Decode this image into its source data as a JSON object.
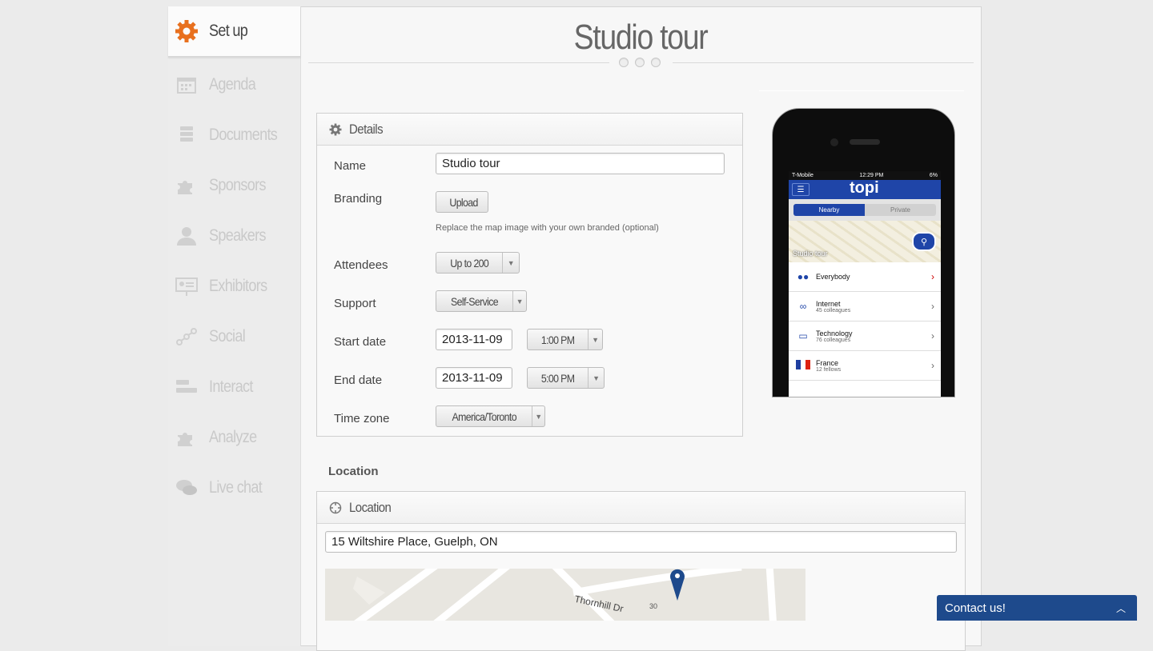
{
  "page": {
    "title": "Studio tour"
  },
  "sidebar": {
    "items": [
      {
        "label": "Set up",
        "icon": "gear-icon",
        "active": true
      },
      {
        "label": "Agenda",
        "icon": "calendar-icon"
      },
      {
        "label": "Documents",
        "icon": "documents-icon"
      },
      {
        "label": "Sponsors",
        "icon": "puzzle-icon"
      },
      {
        "label": "Speakers",
        "icon": "person-icon"
      },
      {
        "label": "Exhibitors",
        "icon": "presentation-icon"
      },
      {
        "label": "Social",
        "icon": "network-icon"
      },
      {
        "label": "Interact",
        "icon": "interact-icon"
      },
      {
        "label": "Analyze",
        "icon": "puzzle-icon"
      },
      {
        "label": "Live chat",
        "icon": "chat-bubbles-icon"
      }
    ]
  },
  "details": {
    "heading": "Details",
    "name_label": "Name",
    "name_value": "Studio tour",
    "branding_label": "Branding",
    "upload_label": "Upload",
    "branding_hint": "Replace the map image with your own branded (optional)",
    "attendees_label": "Attendees",
    "attendees_value": "Up to 200",
    "support_label": "Support",
    "support_value": "Self-Service",
    "start_label": "Start date",
    "start_date": "2013-11-09",
    "start_time": "1:00 PM",
    "end_label": "End date",
    "end_date": "2013-11-09",
    "end_time": "5:00 PM",
    "tz_label": "Time zone",
    "tz_value": "America/Toronto"
  },
  "location": {
    "section_label": "Location",
    "heading": "Location",
    "address": "15 Wiltshire Place, Guelph, ON",
    "map_street": "Thornhill Dr",
    "map_number": "30"
  },
  "phone": {
    "carrier": "T-Mobile",
    "time": "12:29 PM",
    "battery": "6%",
    "logo": "topi",
    "tab_on": "Nearby",
    "tab_off": "Private",
    "map_label": "Studio tour",
    "rows": [
      {
        "title": "Everybody",
        "sub": ""
      },
      {
        "title": "Internet",
        "sub": "45 colleagues"
      },
      {
        "title": "Technology",
        "sub": "76 colleagues"
      },
      {
        "title": "France",
        "sub": "12 fellows"
      }
    ]
  },
  "contact": {
    "label": "Contact us!"
  },
  "colors": {
    "accent": "#e8701e",
    "brand_blue": "#1f45a8",
    "contact_bg": "#1e4a8c"
  }
}
